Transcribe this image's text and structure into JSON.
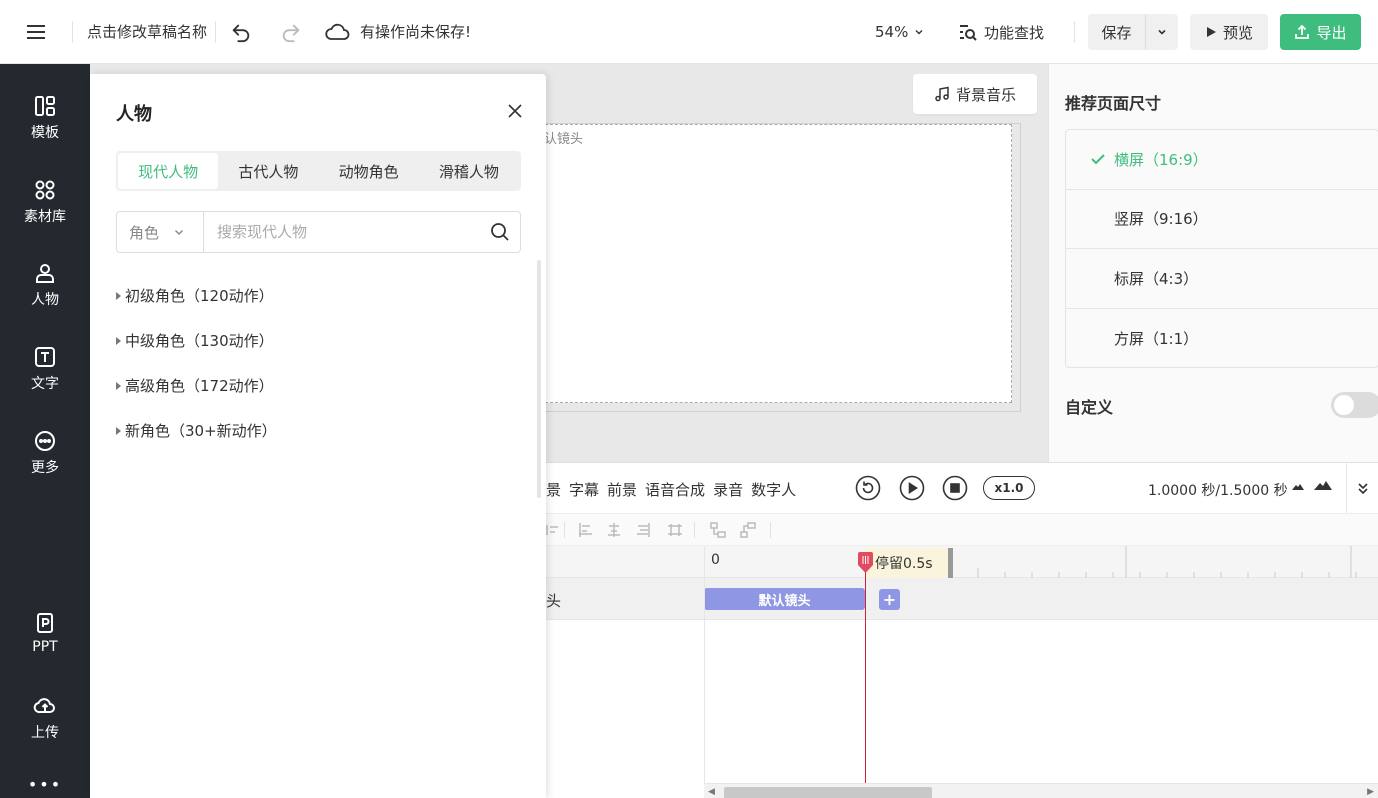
{
  "topbar": {
    "draft_name": "点击修改草稿名称",
    "save_status": "有操作尚未保存!",
    "zoom": "54%",
    "feature_search": "功能查找",
    "save": "保存",
    "preview": "预览",
    "export": "导出"
  },
  "sidebar": {
    "items": [
      {
        "label": "模板",
        "icon": "template-icon"
      },
      {
        "label": "素材库",
        "icon": "material-library-icon"
      },
      {
        "label": "人物",
        "icon": "person-icon"
      },
      {
        "label": "文字",
        "icon": "text-icon"
      },
      {
        "label": "更多",
        "icon": "more-icon"
      },
      {
        "label": "PPT",
        "icon": "ppt-icon"
      },
      {
        "label": "上传",
        "icon": "upload-icon"
      }
    ],
    "overflow": "•••"
  },
  "canvas": {
    "bgm_label": "背景音乐",
    "stage_label": "认镜头"
  },
  "right_panel": {
    "title": "推荐页面尺寸",
    "sizes": [
      {
        "label": "横屏（16:9）",
        "active": true
      },
      {
        "label": "竖屏（9:16）",
        "active": false
      },
      {
        "label": "标屏（4:3）",
        "active": false
      },
      {
        "label": "方屏（1:1）",
        "active": false
      }
    ],
    "custom_label": "自定义",
    "custom_enabled": false
  },
  "people_panel": {
    "title": "人物",
    "tabs": [
      "现代人物",
      "古代人物",
      "动物角色",
      "滑稽人物"
    ],
    "active_tab": 0,
    "role_select": "角色",
    "search_placeholder": "搜索现代人物",
    "groups": [
      "初级角色（120动作）",
      "中级角色（130动作）",
      "高级角色（172动作）",
      "新角色（30+新动作）"
    ]
  },
  "timeline": {
    "tabs": [
      "景",
      "字幕",
      "前景",
      "语音合成",
      "录音",
      "数字人"
    ],
    "speed": "x1.0",
    "time": "1.0000 秒/1.5000 秒",
    "ruler_zero": "0",
    "pause_label": "停留0.5s",
    "row_label": "头",
    "clip_label": "默认镜头",
    "add_label": "+"
  },
  "colors": {
    "accent": "#3fbd7f",
    "sidebar_bg": "#23292f",
    "clip": "#8f97e4",
    "playhead": "#d21f3c"
  }
}
